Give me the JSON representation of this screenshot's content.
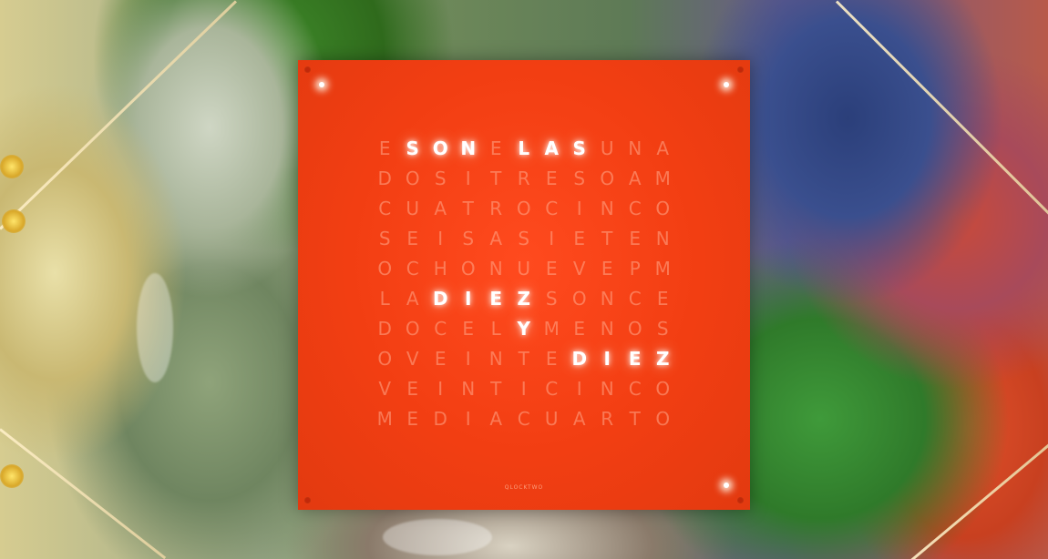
{
  "clock": {
    "grid": [
      [
        "E",
        "S",
        "O",
        "N",
        "E",
        "L",
        "A",
        "S",
        "U",
        "N",
        "A"
      ],
      [
        "D",
        "O",
        "S",
        "I",
        "T",
        "R",
        "E",
        "S",
        "O",
        "A",
        "M"
      ],
      [
        "C",
        "U",
        "A",
        "T",
        "R",
        "O",
        "C",
        "I",
        "N",
        "C",
        "O"
      ],
      [
        "S",
        "E",
        "I",
        "S",
        "A",
        "S",
        "I",
        "E",
        "T",
        "E",
        "N"
      ],
      [
        "O",
        "C",
        "H",
        "O",
        "N",
        "U",
        "E",
        "V",
        "E",
        "P",
        "M"
      ],
      [
        "L",
        "A",
        "D",
        "I",
        "E",
        "Z",
        "S",
        "O",
        "N",
        "C",
        "E"
      ],
      [
        "D",
        "O",
        "C",
        "E",
        "L",
        "Y",
        "M",
        "E",
        "N",
        "O",
        "S"
      ],
      [
        "O",
        "V",
        "E",
        "I",
        "N",
        "T",
        "E",
        "D",
        "I",
        "E",
        "Z"
      ],
      [
        "V",
        "E",
        "I",
        "N",
        "T",
        "I",
        "C",
        "I",
        "N",
        "C",
        "O"
      ],
      [
        "M",
        "E",
        "D",
        "I",
        "A",
        "C",
        "U",
        "A",
        "R",
        "T",
        "O"
      ]
    ],
    "lit": [
      [
        1,
        2,
        3,
        5,
        6,
        7
      ],
      [],
      [],
      [],
      [],
      [
        2,
        3,
        4,
        5
      ],
      [
        5
      ],
      [
        7,
        8,
        9,
        10
      ],
      [],
      []
    ],
    "lit_words": [
      "SON",
      "LAS",
      "DIEZ",
      "Y",
      "DIEZ"
    ],
    "brand": "QLOCKTWO",
    "panel_color": "#f23e12",
    "lit_color": "#ffffff",
    "unlit_color": "#ffaa8c"
  }
}
